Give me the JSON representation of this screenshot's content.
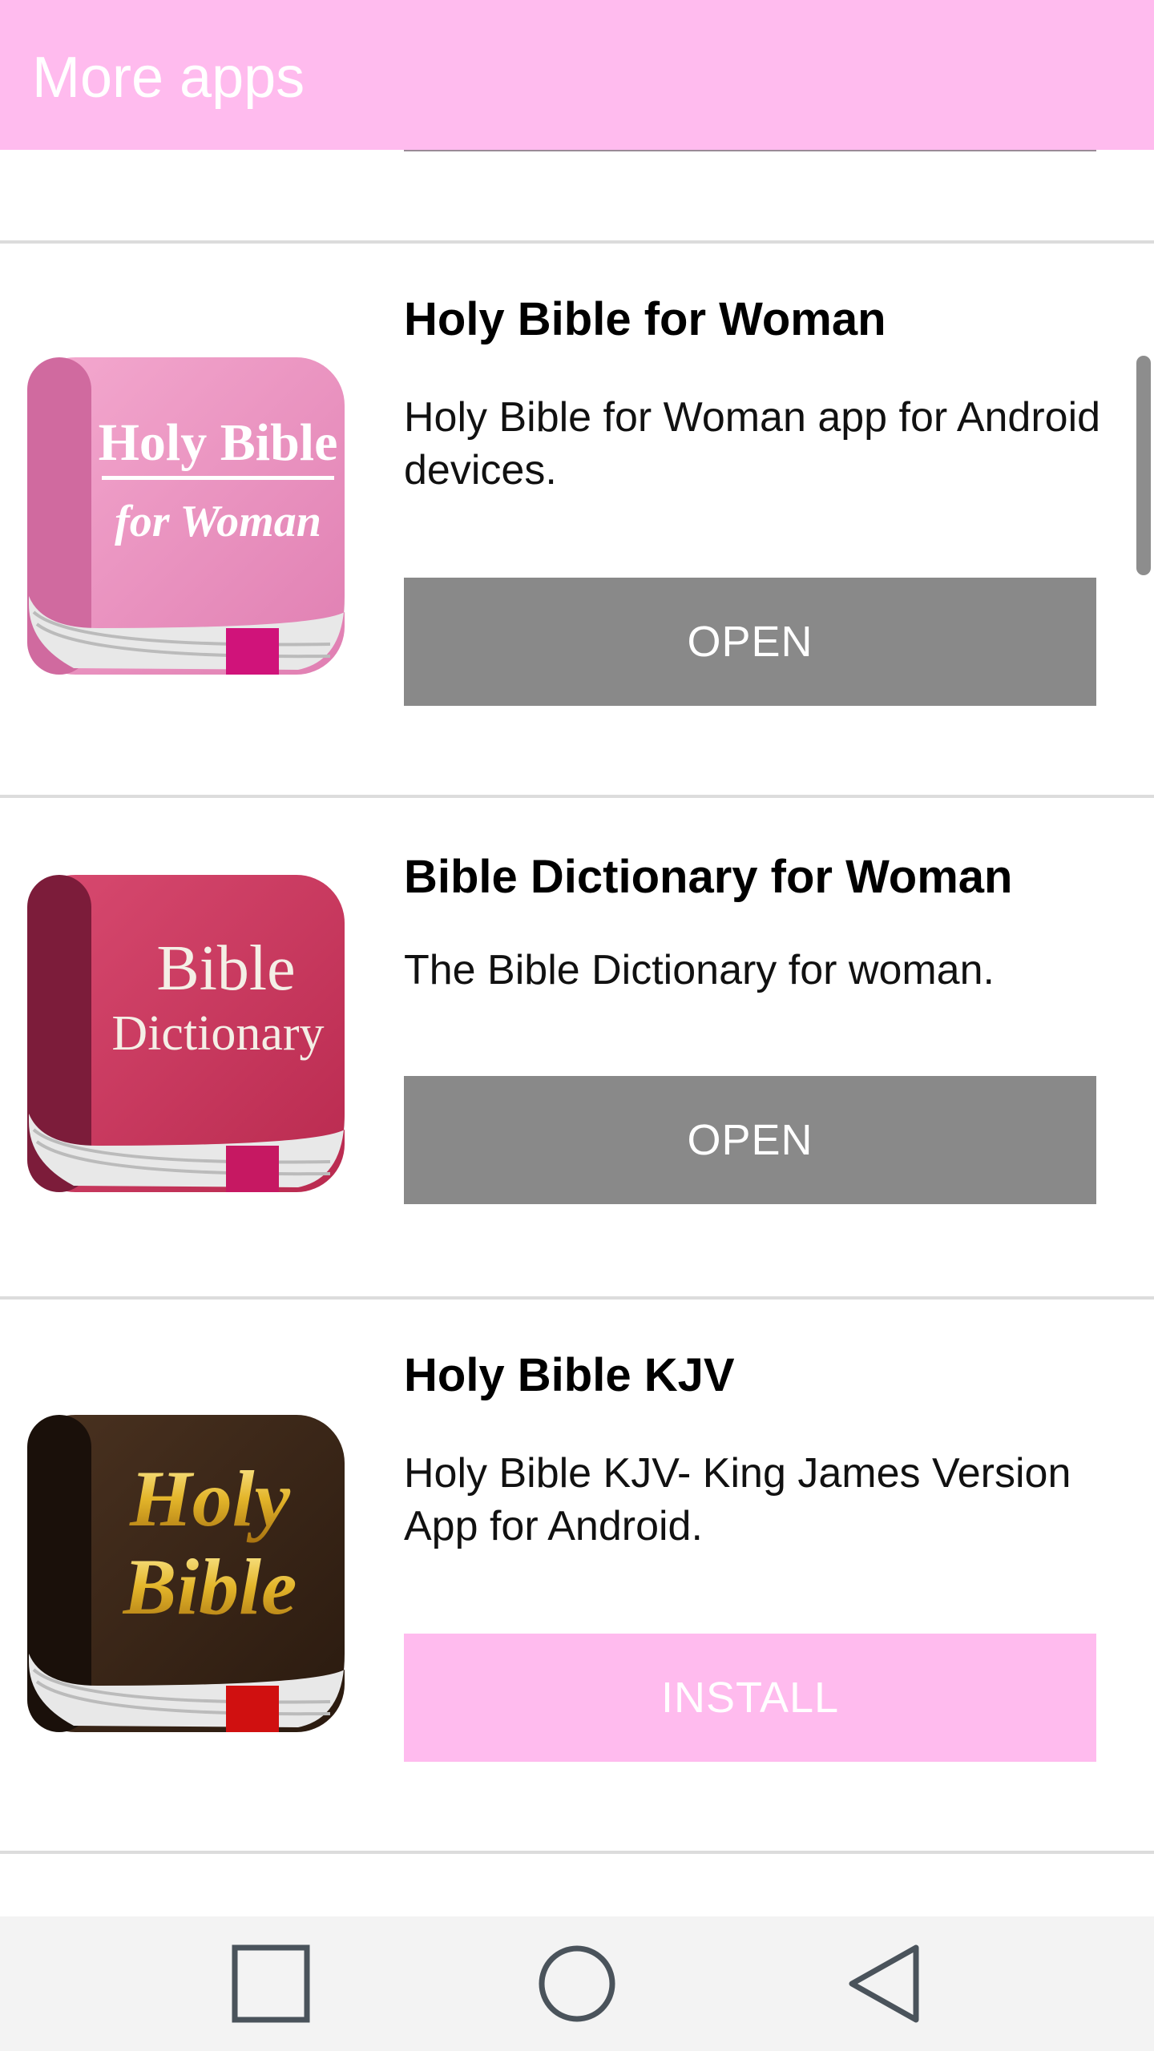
{
  "app_bar": {
    "title": "More apps",
    "background_color": "#ffbbee"
  },
  "apps": [
    {
      "title": "Holy Bible for Woman",
      "description": "Holy Bible for Woman app for Android devices.",
      "button": "OPEN",
      "button_state": "installed",
      "icon": "holy-bible-for-woman-icon",
      "icon_text_line1": "Holy Bible",
      "icon_text_line2": "for Woman"
    },
    {
      "title": "Bible Dictionary for Woman",
      "description": "The Bible Dictionary for woman.",
      "button": "OPEN",
      "button_state": "installed",
      "icon": "bible-dictionary-icon",
      "icon_text_line1": "Bible",
      "icon_text_line2": "Dictionary"
    },
    {
      "title": "Holy Bible KJV",
      "description": "Holy Bible KJV- King James Version App for Android.",
      "button": "INSTALL",
      "button_state": "not-installed",
      "icon": "holy-bible-kjv-icon",
      "icon_text_line1": "Holy",
      "icon_text_line2": "Bible"
    }
  ],
  "colors": {
    "accent": "#ffbbee",
    "open_button": "#898989",
    "divider": "#dcdcdc"
  },
  "nav_bar": {
    "buttons": [
      "recents-square-icon",
      "home-circle-icon",
      "back-triangle-icon"
    ]
  }
}
